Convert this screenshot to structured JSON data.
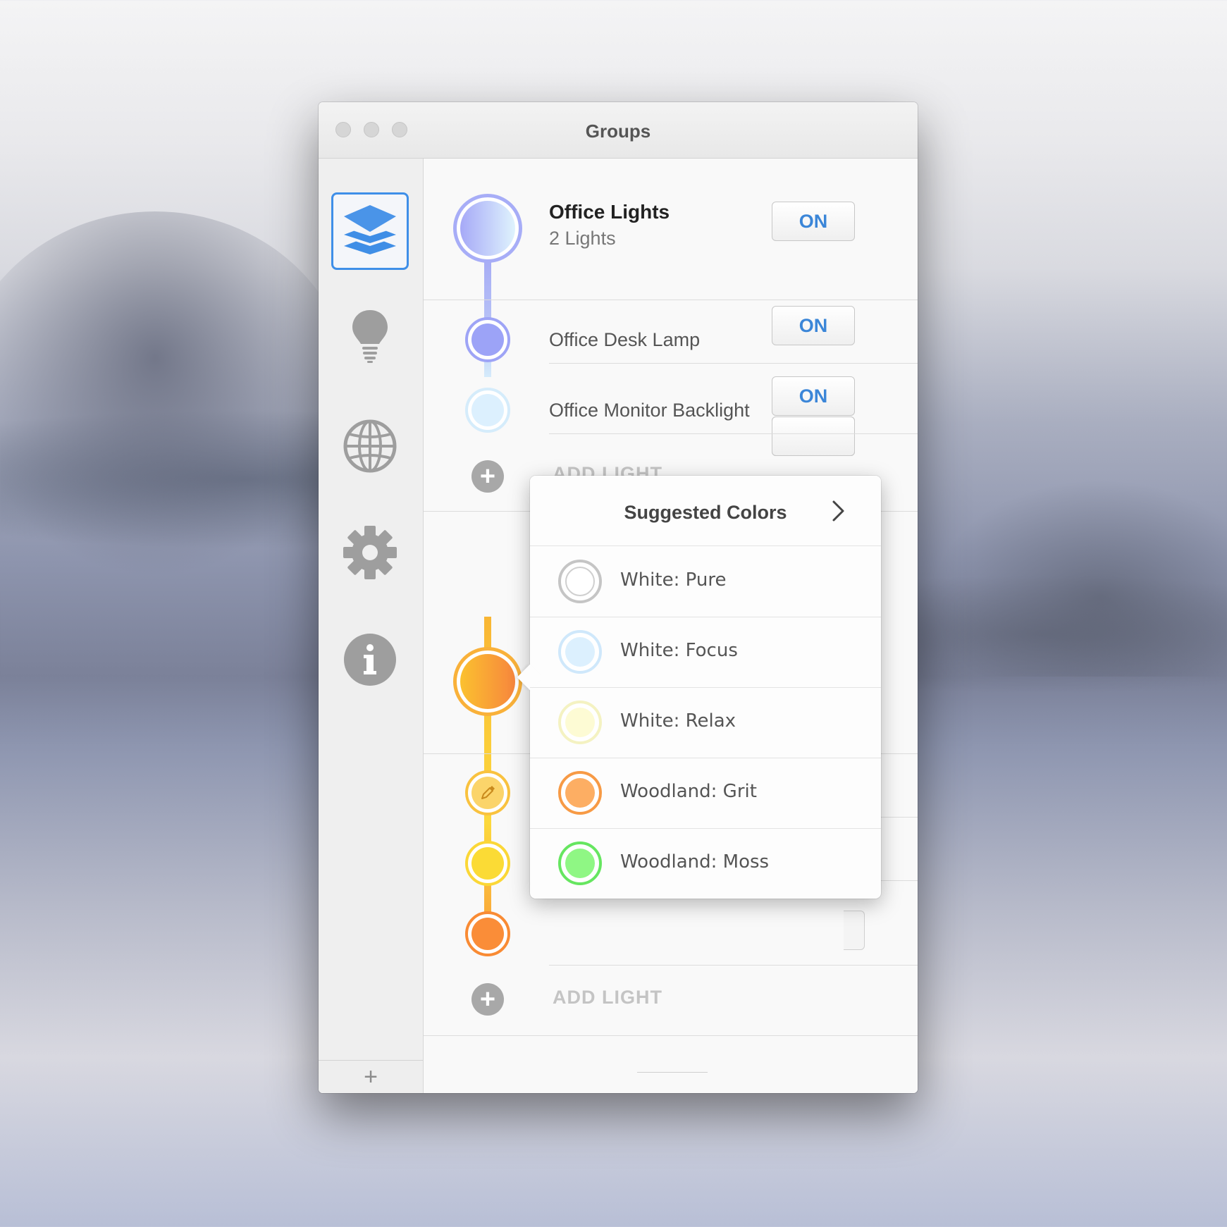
{
  "window": {
    "title": "Groups"
  },
  "sidebar": {
    "items": [
      {
        "id": "groups",
        "icon": "layers-icon",
        "active": true
      },
      {
        "id": "lights",
        "icon": "lightbulb-icon",
        "active": false
      },
      {
        "id": "world",
        "icon": "globe-icon",
        "active": false
      },
      {
        "id": "settings",
        "icon": "gear-icon",
        "active": false
      },
      {
        "id": "info",
        "icon": "info-icon",
        "active": false
      }
    ],
    "add_label": "+"
  },
  "groups": [
    {
      "name": "Office Lights",
      "count": "2 Lights",
      "state_label": "ON",
      "accent": "#9fa6f5",
      "lights": [
        {
          "name": "Office Desk Lamp",
          "state_label": "ON",
          "color": "#9ca3f7"
        },
        {
          "name": "Office Monitor Backlight",
          "state_label": "ON",
          "color": "#d7eefb"
        }
      ],
      "add_label": "ADD LIGHT"
    },
    {
      "accent": "#f9a830",
      "lights": [
        {
          "color": "#fbd46a"
        },
        {
          "color": "#fbdb35"
        },
        {
          "color": "#fa8d38"
        }
      ],
      "add_label": "ADD LIGHT"
    }
  ],
  "popover": {
    "title": "Suggested Colors",
    "items": [
      {
        "label": "White: Pure",
        "color": "#ffffff",
        "ring": "#c5c5c5"
      },
      {
        "label": "White: Focus",
        "color": "#dcf0fe",
        "ring": "#cfe8fb"
      },
      {
        "label": "White: Relax",
        "color": "#fdfbd4",
        "ring": "#f4f2c2"
      },
      {
        "label": "Woodland: Grit",
        "color": "#fdae63",
        "ring": "#f79a45"
      },
      {
        "label": "Woodland: Moss",
        "color": "#8ff784",
        "ring": "#66e660"
      }
    ]
  }
}
